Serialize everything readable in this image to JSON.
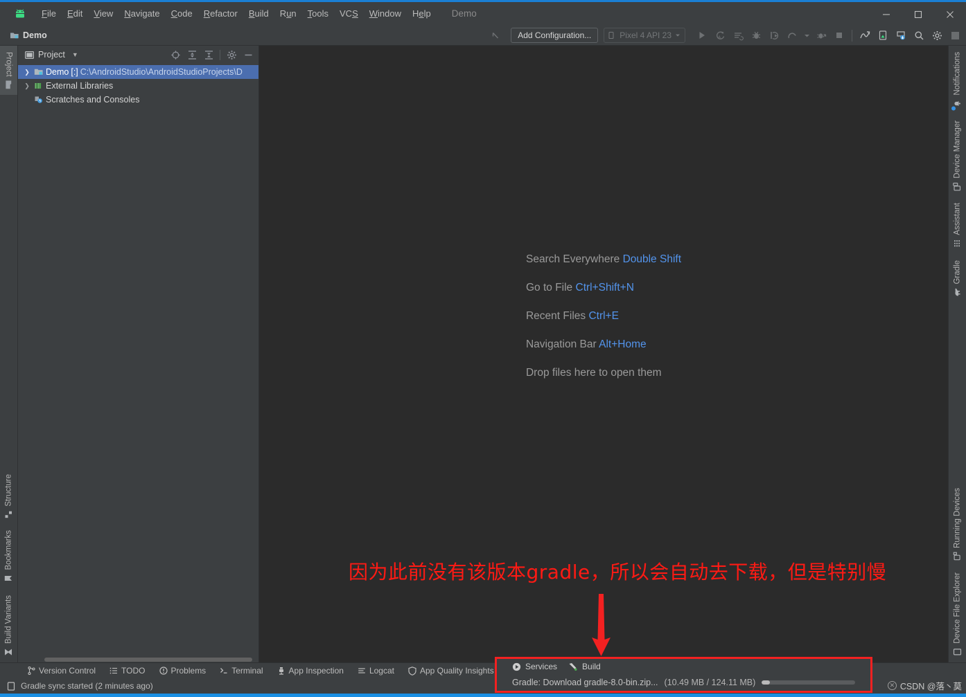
{
  "window": {
    "project_name": "Demo",
    "minimize": "—",
    "maximize": "▢",
    "close": "✕"
  },
  "menubar": {
    "items": [
      {
        "label": "File",
        "mnemonic": "F"
      },
      {
        "label": "Edit",
        "mnemonic": "E"
      },
      {
        "label": "View",
        "mnemonic": "V"
      },
      {
        "label": "Navigate",
        "mnemonic": "N"
      },
      {
        "label": "Code",
        "mnemonic": "C"
      },
      {
        "label": "Refactor",
        "mnemonic": "R"
      },
      {
        "label": "Build",
        "mnemonic": "B"
      },
      {
        "label": "Run",
        "mnemonic": "u"
      },
      {
        "label": "Tools",
        "mnemonic": "T"
      },
      {
        "label": "VCS",
        "mnemonic": "S"
      },
      {
        "label": "Window",
        "mnemonic": "W"
      },
      {
        "label": "Help",
        "mnemonic": "H"
      }
    ]
  },
  "navbar": {
    "breadcrumb": "Demo",
    "add_configuration": "Add Configuration...",
    "device_selector": "Pixel 4 API 23"
  },
  "project_panel": {
    "title": "Project",
    "tree": [
      {
        "label": "Demo",
        "suffix": "[:]",
        "path": "C:\\AndroidStudio\\AndroidStudioProjects\\D",
        "selected": true,
        "expandable": true,
        "indent": 0
      },
      {
        "label": "External Libraries",
        "suffix": "",
        "path": "",
        "selected": false,
        "expandable": true,
        "indent": 0
      },
      {
        "label": "Scratches and Consoles",
        "suffix": "",
        "path": "",
        "selected": false,
        "expandable": false,
        "indent": 0
      }
    ]
  },
  "editor": {
    "welcome": [
      {
        "action": "Search Everywhere",
        "shortcut": "Double Shift"
      },
      {
        "action": "Go to File",
        "shortcut": "Ctrl+Shift+N"
      },
      {
        "action": "Recent Files",
        "shortcut": "Ctrl+E"
      },
      {
        "action": "Navigation Bar",
        "shortcut": "Alt+Home"
      },
      {
        "action": "Drop files here to open them",
        "shortcut": ""
      }
    ]
  },
  "left_strip": {
    "top": [
      {
        "label": "Project",
        "icon": "project-icon",
        "selected": true
      }
    ],
    "bottom": [
      {
        "label": "Structure",
        "icon": "structure-icon"
      },
      {
        "label": "Bookmarks",
        "icon": "bookmark-icon"
      },
      {
        "label": "Build Variants",
        "icon": "build-variants-icon"
      }
    ]
  },
  "right_strip": {
    "top": [
      {
        "label": "Notifications",
        "icon": "notifications-icon"
      },
      {
        "label": "Device Manager",
        "icon": "device-manager-icon"
      },
      {
        "label": "Assistant",
        "icon": "assistant-icon"
      },
      {
        "label": "Gradle",
        "icon": "gradle-elephant-icon"
      }
    ],
    "bottom": [
      {
        "label": "Running Devices",
        "icon": "running-devices-icon"
      },
      {
        "label": "Device File Explorer",
        "icon": "device-file-explorer-icon"
      }
    ]
  },
  "bottom_bar": {
    "tabs": [
      {
        "label": "Version Control",
        "icon": "branch-icon"
      },
      {
        "label": "TODO",
        "icon": "todo-list-icon"
      },
      {
        "label": "Problems",
        "icon": "warning-icon"
      },
      {
        "label": "Terminal",
        "icon": "terminal-icon"
      },
      {
        "label": "App Inspection",
        "icon": "app-inspection-icon"
      },
      {
        "label": "Logcat",
        "icon": "logcat-icon"
      },
      {
        "label": "App Quality Insights",
        "icon": "shield-icon"
      }
    ]
  },
  "status_bar": {
    "message": "Gradle sync started (2 minutes ago)",
    "icon": "event-log-icon"
  },
  "build_panel": {
    "tabs": [
      {
        "label": "Services",
        "icon": "services-play-icon"
      },
      {
        "label": "Build",
        "icon": "build-hammer-icon"
      }
    ],
    "task": "Gradle: Download gradle-8.0-bin.zip...",
    "size": "(10.49 MB / 124.11 MB)",
    "progress_percent": 8.5,
    "highlight_color": "#f32121"
  },
  "annotation": {
    "text": "因为此前没有该版本gradle，所以会自动去下载，但是特别慢",
    "color": "#ff1a14",
    "arrow": "down-arrow-annotation"
  },
  "watermark": {
    "text": "CSDN @落丶莫"
  }
}
